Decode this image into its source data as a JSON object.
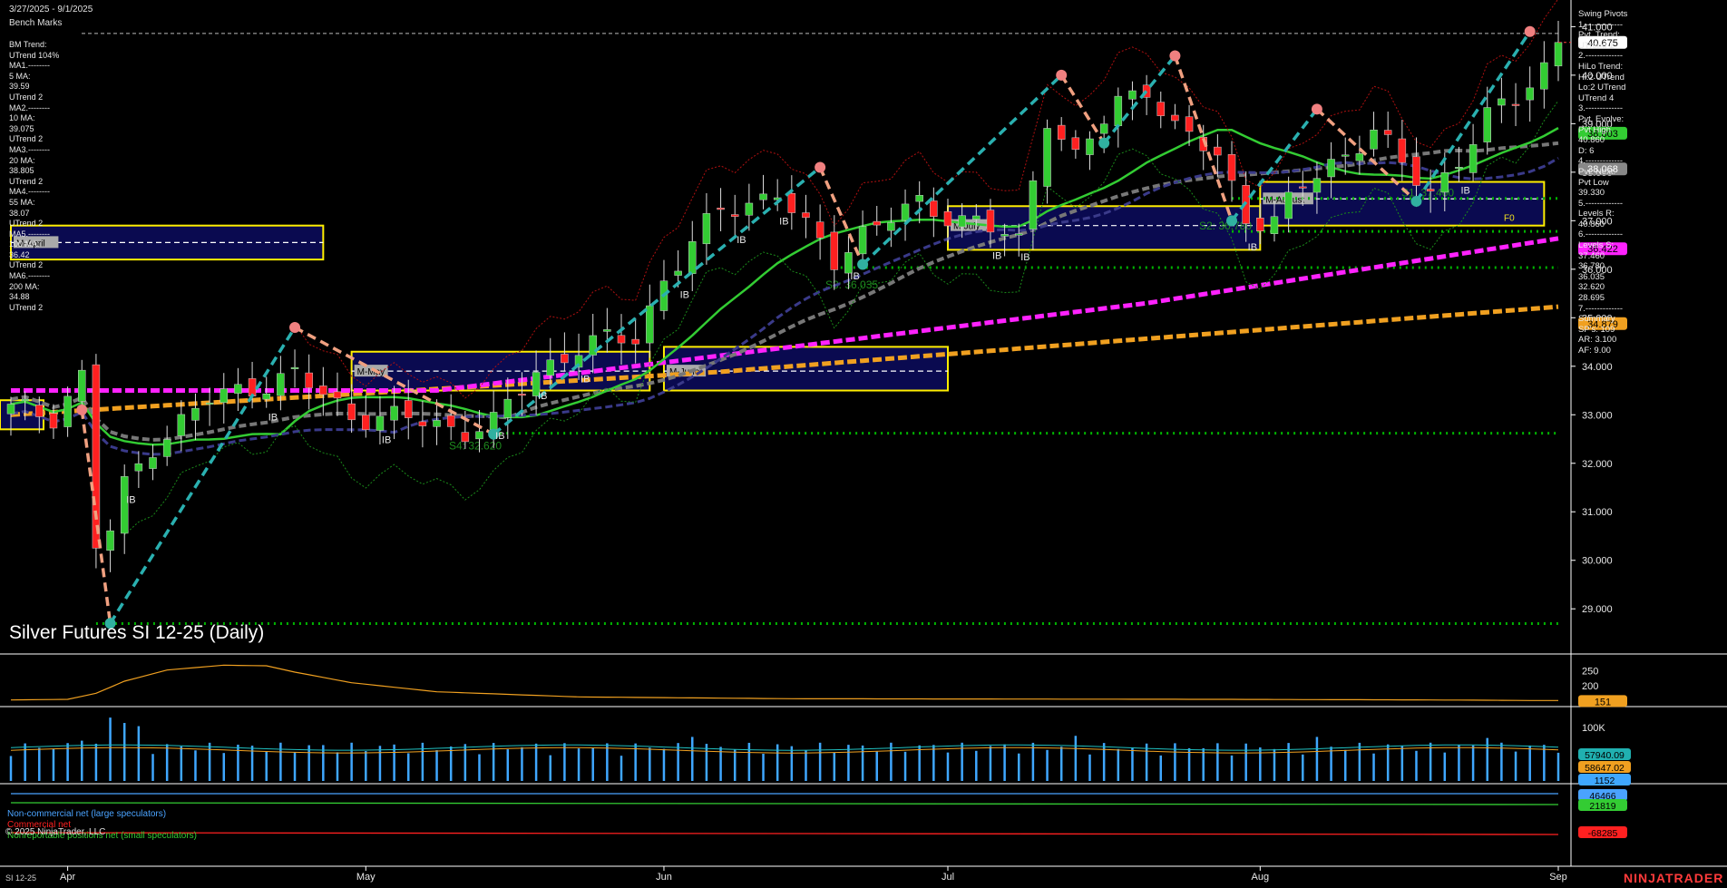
{
  "header": {
    "date_range": "3/27/2025 - 9/1/2025",
    "bench_marks": "Bench Marks"
  },
  "left_legend": [
    "BM Trend:",
    "UTrend 104%",
    "MA1.--------",
    "5 MA:",
    "39.59",
    "UTrend 2",
    "MA2.--------",
    "10 MA:",
    "39.075",
    "UTrend 2",
    "MA3.--------",
    "20 MA:",
    "38.805",
    "UTrend 2",
    "MA4.--------",
    "55 MA:",
    "38.07",
    "UTrend 2",
    "MA5.--------",
    "100 MA:",
    "36.42",
    "UTrend 2",
    "MA6.--------",
    "200 MA:",
    "34.88",
    "UTrend 2"
  ],
  "right_legend": [
    "Swing Pivots",
    "1.-------------",
    "Pvt. Trend:",
    "UTrend 1",
    "2.-------------",
    "HiLo Trend:",
    "Hi:2 UTrend",
    "Lo:2 UTrend",
    "UTrend 4",
    "3.-------------",
    "Pvt. Evolve:",
    "Pvt High",
    "40.860",
    "D: 6",
    "4.-------------",
    "Pvt. Next:",
    "Pvt Low",
    "39.330",
    "5.-------------",
    "Levels R:",
    "40.860",
    "6.-------------",
    "Levels S:",
    "37.460",
    "36.780",
    "36.035",
    "32.620",
    "28.695",
    "7.-------------",
    "Summary",
    "SP's: 109",
    "AR: 3.100",
    "AF: 9.00"
  ],
  "title": "Silver Futures SI 12-25 (Daily)",
  "copyright": "© 2025 NinjaTrader, LLC",
  "cot_legend": {
    "large": "Non-commercial net (large speculators)",
    "commercial": "Commercial net",
    "small": "Nonreportable positions net (small speculators)"
  },
  "instrument": "SI 12-25",
  "brand": "NINJATRADER",
  "colors": {
    "bull": "#33cc33",
    "bear": "#ff2020",
    "ma20": "#33cc33",
    "ma55": "#777777",
    "ma100": "#ff22ff",
    "ma200": "#f0a020",
    "ma_navy": "#3a3a8a",
    "swing_up": "#2ab0b0",
    "swing_down": "#f0a080",
    "support": "#00b400",
    "monthly_box": "#ffee00",
    "box_fill": "#0a0a50"
  },
  "chart_data": [
    {
      "type": "candlestick",
      "title": "Silver Futures SI 12-25 (Daily)",
      "y_ticks": [
        29000,
        30000,
        31000,
        32000,
        33000,
        34000,
        35000,
        36000,
        37000,
        38000,
        39000,
        40000,
        41000
      ],
      "y_tick_labels": [
        "29.000",
        "30.000",
        "31.000",
        "32.000",
        "33.000",
        "34.000",
        "35.000",
        "36.000",
        "37.000",
        "38.000",
        "39.000",
        "40.000",
        "41.000"
      ],
      "ylim": [
        28200,
        41400
      ],
      "x_labels": [
        "Apr",
        "May",
        "Jun",
        "Jul",
        "Aug",
        "Sep"
      ],
      "x_label_index": [
        4,
        25,
        46,
        66,
        88,
        109
      ],
      "n_bars": 110,
      "close_key_points": [
        [
          0,
          33.1
        ],
        [
          3,
          33.0
        ],
        [
          5,
          33.8
        ],
        [
          6,
          30.3
        ],
        [
          7,
          30.6
        ],
        [
          8,
          31.5
        ],
        [
          10,
          32.4
        ],
        [
          14,
          33.3
        ],
        [
          17,
          33.6
        ],
        [
          20,
          33.8
        ],
        [
          24,
          33.0
        ],
        [
          28,
          32.9
        ],
        [
          32,
          32.7
        ],
        [
          34,
          32.8
        ],
        [
          37,
          33.9
        ],
        [
          40,
          34.4
        ],
        [
          44,
          34.6
        ],
        [
          46,
          35.8
        ],
        [
          50,
          37.2
        ],
        [
          54,
          37.6
        ],
        [
          56,
          36.8
        ],
        [
          58,
          36.2
        ],
        [
          60,
          36.8
        ],
        [
          64,
          37.3
        ],
        [
          68,
          37.0
        ],
        [
          71,
          36.5
        ],
        [
          73,
          39.2
        ],
        [
          75,
          38.3
        ],
        [
          78,
          39.4
        ],
        [
          80,
          39.8
        ],
        [
          82,
          38.9
        ],
        [
          85,
          38.3
        ],
        [
          87,
          37.1
        ],
        [
          89,
          37.0
        ],
        [
          91,
          37.7
        ],
        [
          94,
          38.4
        ],
        [
          96,
          38.9
        ],
        [
          98,
          38.1
        ],
        [
          100,
          37.6
        ],
        [
          102,
          38.3
        ],
        [
          104,
          39.1
        ],
        [
          106,
          39.5
        ],
        [
          108,
          40.2
        ]
      ],
      "current_price": 40.675,
      "price_labels": [
        {
          "value": 40.675,
          "text": "40.675",
          "color": "#ffffff",
          "text_color": "#000000"
        },
        {
          "value": 38.803,
          "text": "38.803",
          "color": "#33cc33",
          "text_color": "#000000"
        },
        {
          "value": 38.068,
          "text": "38.068",
          "color": "#888888",
          "text_color": "#ffffff"
        },
        {
          "value": 36.422,
          "text": "36.422",
          "color": "#ff22ff",
          "text_color": "#000000"
        },
        {
          "value": 34.879,
          "text": "34.879",
          "color": "#f0a020",
          "text_color": "#000000"
        }
      ],
      "support_levels": [
        {
          "label": "S1: 37.460",
          "value": 37.46
        },
        {
          "label": "S2: 36.780",
          "value": 36.78
        },
        {
          "label": "S3: 36.035",
          "value": 36.035
        },
        {
          "label": "S4: 32.620",
          "value": 32.62
        },
        {
          "label": "",
          "value": 28.695
        }
      ],
      "resistance_level": 40.86,
      "monthly_boxes": [
        {
          "label": "M-April",
          "start": 0,
          "end": 22,
          "low": 36.2,
          "high": 36.9,
          "mid": 36.55
        },
        {
          "label": "M-May",
          "start": 24,
          "end": 45,
          "low": 33.5,
          "high": 34.3,
          "mid": 33.9
        },
        {
          "label": "M-June",
          "start": 46,
          "end": 66,
          "low": 33.5,
          "high": 34.4,
          "mid": 33.9
        },
        {
          "label": "M-July",
          "start": 66,
          "end": 88,
          "low": 36.4,
          "high": 37.3,
          "mid": 36.9
        },
        {
          "label": "M-August",
          "start": 88,
          "end": 108,
          "low": 36.9,
          "high": 37.8,
          "mid": 37.45
        }
      ],
      "swing_points": [
        [
          5,
          33.1
        ],
        [
          7,
          28.7
        ],
        [
          20,
          34.8
        ],
        [
          34,
          32.6
        ],
        [
          57,
          38.1
        ],
        [
          60,
          36.1
        ],
        [
          74,
          40.0
        ],
        [
          77,
          38.6
        ],
        [
          82,
          40.4
        ],
        [
          86,
          37.0
        ],
        [
          92,
          39.3
        ],
        [
          99,
          37.4
        ],
        [
          107,
          40.9
        ]
      ],
      "ib_marks": [
        8,
        18,
        26,
        34,
        37,
        40,
        47,
        51,
        54,
        59,
        69,
        71,
        87,
        102
      ],
      "note": "F0"
    },
    {
      "type": "line",
      "name_panel": "oscillator",
      "y_tick_labels": [
        "200",
        "250"
      ],
      "y_ticks": [
        200,
        250
      ],
      "ylim": [
        140,
        290
      ],
      "last_value_label": "151",
      "values_key_points": [
        [
          0,
          153
        ],
        [
          4,
          155
        ],
        [
          6,
          175
        ],
        [
          8,
          215
        ],
        [
          11,
          252
        ],
        [
          15,
          268
        ],
        [
          18,
          266
        ],
        [
          20,
          245
        ],
        [
          24,
          210
        ],
        [
          30,
          180
        ],
        [
          40,
          163
        ],
        [
          55,
          157
        ],
        [
          70,
          156
        ],
        [
          85,
          155
        ],
        [
          100,
          153
        ],
        [
          108,
          151
        ]
      ]
    },
    {
      "type": "bar",
      "name_panel": "volume",
      "y_tick_labels": [
        "100K"
      ],
      "y_ticks": [
        100000
      ],
      "ylim": [
        0,
        130000
      ],
      "labels": [
        "57940.09",
        "58647.02",
        "1152"
      ],
      "spike_bars": [
        [
          7,
          118000
        ],
        [
          8,
          108000
        ],
        [
          9,
          102000
        ],
        [
          5,
          75000
        ],
        [
          48,
          82000
        ],
        [
          75,
          84000
        ],
        [
          92,
          82000
        ],
        [
          104,
          80000
        ]
      ],
      "typical_volume": 62000
    },
    {
      "type": "line",
      "name_panel": "cot",
      "labels": [
        "46466",
        "21819",
        "-68285"
      ],
      "series": [
        {
          "name": "Non-commercial net (large speculators)",
          "value": 46466
        },
        {
          "name": "Commercial net",
          "value": -68285
        },
        {
          "name": "Nonreportable positions net (small speculators)",
          "value": 21819
        }
      ]
    }
  ]
}
